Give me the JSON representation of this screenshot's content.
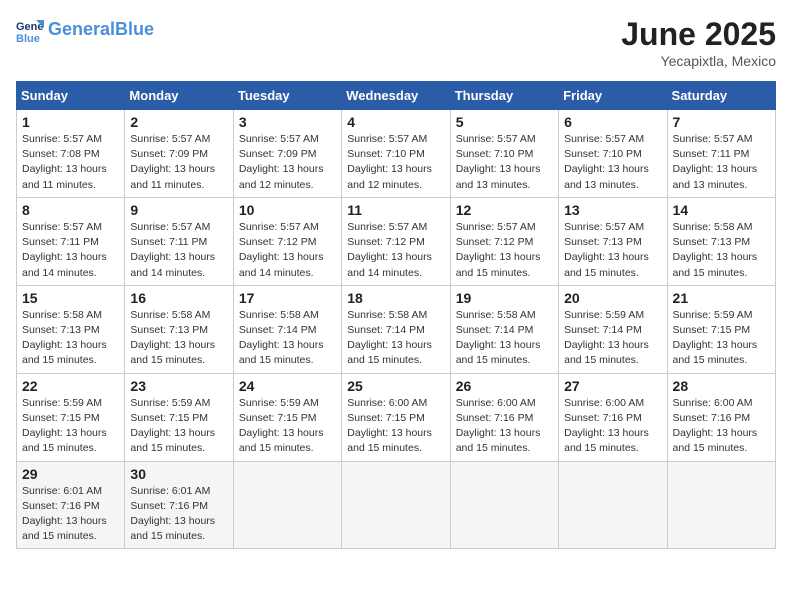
{
  "header": {
    "logo_line1": "General",
    "logo_line2": "Blue",
    "month_year": "June 2025",
    "location": "Yecapixtla, Mexico"
  },
  "weekdays": [
    "Sunday",
    "Monday",
    "Tuesday",
    "Wednesday",
    "Thursday",
    "Friday",
    "Saturday"
  ],
  "weeks": [
    [
      {
        "day": "1",
        "info": "Sunrise: 5:57 AM\nSunset: 7:08 PM\nDaylight: 13 hours\nand 11 minutes."
      },
      {
        "day": "2",
        "info": "Sunrise: 5:57 AM\nSunset: 7:09 PM\nDaylight: 13 hours\nand 11 minutes."
      },
      {
        "day": "3",
        "info": "Sunrise: 5:57 AM\nSunset: 7:09 PM\nDaylight: 13 hours\nand 12 minutes."
      },
      {
        "day": "4",
        "info": "Sunrise: 5:57 AM\nSunset: 7:10 PM\nDaylight: 13 hours\nand 12 minutes."
      },
      {
        "day": "5",
        "info": "Sunrise: 5:57 AM\nSunset: 7:10 PM\nDaylight: 13 hours\nand 13 minutes."
      },
      {
        "day": "6",
        "info": "Sunrise: 5:57 AM\nSunset: 7:10 PM\nDaylight: 13 hours\nand 13 minutes."
      },
      {
        "day": "7",
        "info": "Sunrise: 5:57 AM\nSunset: 7:11 PM\nDaylight: 13 hours\nand 13 minutes."
      }
    ],
    [
      {
        "day": "8",
        "info": "Sunrise: 5:57 AM\nSunset: 7:11 PM\nDaylight: 13 hours\nand 14 minutes."
      },
      {
        "day": "9",
        "info": "Sunrise: 5:57 AM\nSunset: 7:11 PM\nDaylight: 13 hours\nand 14 minutes."
      },
      {
        "day": "10",
        "info": "Sunrise: 5:57 AM\nSunset: 7:12 PM\nDaylight: 13 hours\nand 14 minutes."
      },
      {
        "day": "11",
        "info": "Sunrise: 5:57 AM\nSunset: 7:12 PM\nDaylight: 13 hours\nand 14 minutes."
      },
      {
        "day": "12",
        "info": "Sunrise: 5:57 AM\nSunset: 7:12 PM\nDaylight: 13 hours\nand 15 minutes."
      },
      {
        "day": "13",
        "info": "Sunrise: 5:57 AM\nSunset: 7:13 PM\nDaylight: 13 hours\nand 15 minutes."
      },
      {
        "day": "14",
        "info": "Sunrise: 5:58 AM\nSunset: 7:13 PM\nDaylight: 13 hours\nand 15 minutes."
      }
    ],
    [
      {
        "day": "15",
        "info": "Sunrise: 5:58 AM\nSunset: 7:13 PM\nDaylight: 13 hours\nand 15 minutes."
      },
      {
        "day": "16",
        "info": "Sunrise: 5:58 AM\nSunset: 7:13 PM\nDaylight: 13 hours\nand 15 minutes."
      },
      {
        "day": "17",
        "info": "Sunrise: 5:58 AM\nSunset: 7:14 PM\nDaylight: 13 hours\nand 15 minutes."
      },
      {
        "day": "18",
        "info": "Sunrise: 5:58 AM\nSunset: 7:14 PM\nDaylight: 13 hours\nand 15 minutes."
      },
      {
        "day": "19",
        "info": "Sunrise: 5:58 AM\nSunset: 7:14 PM\nDaylight: 13 hours\nand 15 minutes."
      },
      {
        "day": "20",
        "info": "Sunrise: 5:59 AM\nSunset: 7:14 PM\nDaylight: 13 hours\nand 15 minutes."
      },
      {
        "day": "21",
        "info": "Sunrise: 5:59 AM\nSunset: 7:15 PM\nDaylight: 13 hours\nand 15 minutes."
      }
    ],
    [
      {
        "day": "22",
        "info": "Sunrise: 5:59 AM\nSunset: 7:15 PM\nDaylight: 13 hours\nand 15 minutes."
      },
      {
        "day": "23",
        "info": "Sunrise: 5:59 AM\nSunset: 7:15 PM\nDaylight: 13 hours\nand 15 minutes."
      },
      {
        "day": "24",
        "info": "Sunrise: 5:59 AM\nSunset: 7:15 PM\nDaylight: 13 hours\nand 15 minutes."
      },
      {
        "day": "25",
        "info": "Sunrise: 6:00 AM\nSunset: 7:15 PM\nDaylight: 13 hours\nand 15 minutes."
      },
      {
        "day": "26",
        "info": "Sunrise: 6:00 AM\nSunset: 7:16 PM\nDaylight: 13 hours\nand 15 minutes."
      },
      {
        "day": "27",
        "info": "Sunrise: 6:00 AM\nSunset: 7:16 PM\nDaylight: 13 hours\nand 15 minutes."
      },
      {
        "day": "28",
        "info": "Sunrise: 6:00 AM\nSunset: 7:16 PM\nDaylight: 13 hours\nand 15 minutes."
      }
    ],
    [
      {
        "day": "29",
        "info": "Sunrise: 6:01 AM\nSunset: 7:16 PM\nDaylight: 13 hours\nand 15 minutes."
      },
      {
        "day": "30",
        "info": "Sunrise: 6:01 AM\nSunset: 7:16 PM\nDaylight: 13 hours\nand 15 minutes."
      },
      {
        "day": "",
        "info": ""
      },
      {
        "day": "",
        "info": ""
      },
      {
        "day": "",
        "info": ""
      },
      {
        "day": "",
        "info": ""
      },
      {
        "day": "",
        "info": ""
      }
    ]
  ]
}
